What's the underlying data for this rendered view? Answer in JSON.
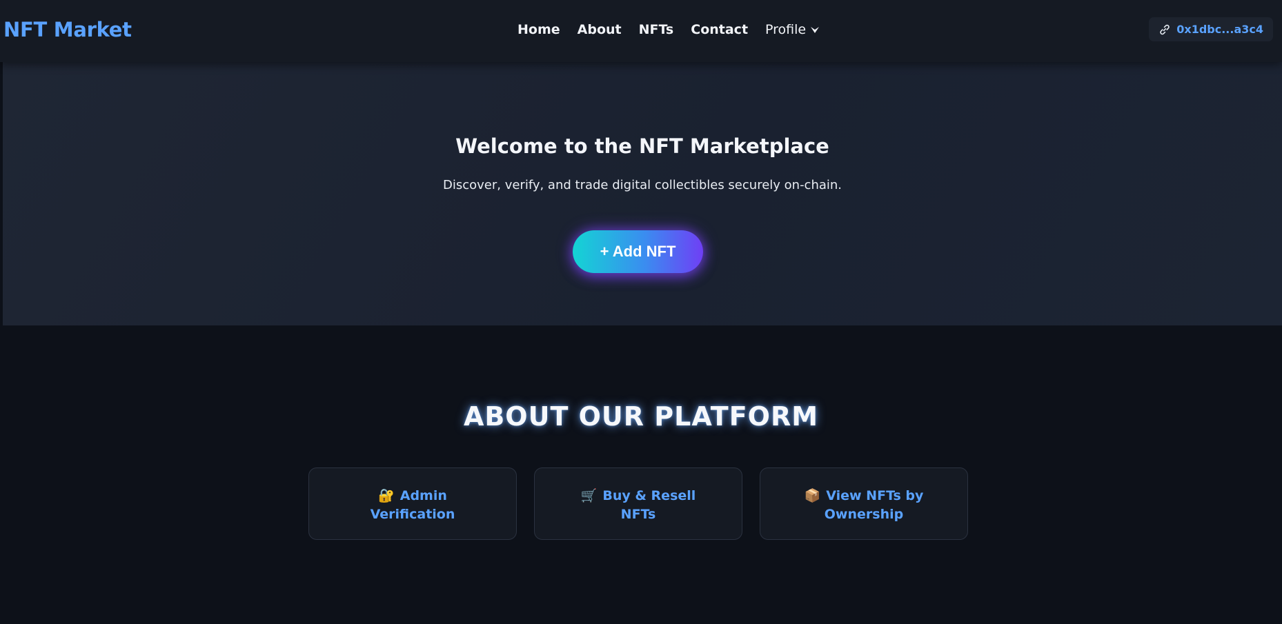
{
  "navbar": {
    "brand": "NFT Market",
    "links": [
      "Home",
      "About",
      "NFTs",
      "Contact"
    ],
    "profile_label": "Profile",
    "wallet_address": "0x1dbc...a3c4"
  },
  "hero": {
    "title": "Welcome to the NFT Marketplace",
    "subtitle": "Discover, verify, and trade digital collectibles securely on-chain.",
    "add_button_label": "+ Add NFT"
  },
  "about": {
    "title": "ABOUT OUR PLATFORM",
    "cards": [
      {
        "icon": "🔐",
        "icon_name": "lock-key-icon",
        "label": "Admin Verification"
      },
      {
        "icon": "🛒",
        "icon_name": "shopping-cart-icon",
        "label": "Buy & Resell NFTs"
      },
      {
        "icon": "📦",
        "icon_name": "package-icon",
        "label": "View NFTs by Ownership"
      }
    ]
  },
  "colors": {
    "accent": "#5aa2ff",
    "background": "#0d1119",
    "navbar": "#151a23",
    "button_gradient_start": "#14d4d4",
    "button_gradient_end": "#6f3ff5"
  }
}
